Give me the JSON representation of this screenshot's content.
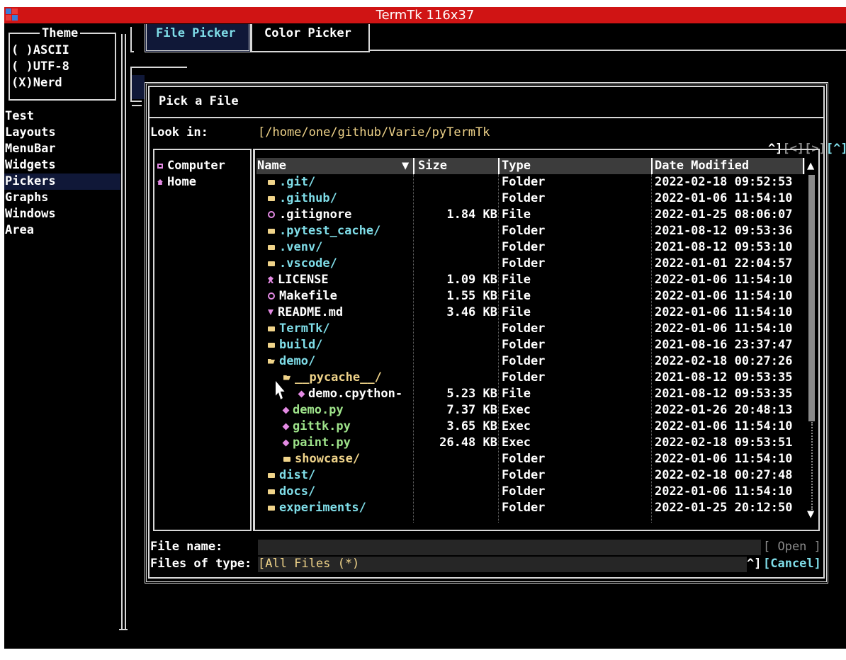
{
  "window": {
    "title": "TermTk 116x37"
  },
  "theme_box": {
    "title": "Theme",
    "options": [
      {
        "mark": "( )",
        "label": "ASCII"
      },
      {
        "mark": "( )",
        "label": "UTF-8"
      },
      {
        "mark": "(X)",
        "label": "Nerd"
      }
    ]
  },
  "sidebar": {
    "items": [
      "Test",
      "Layouts",
      "MenuBar",
      "Widgets",
      "Pickers",
      "Graphs",
      "Windows",
      "Area"
    ],
    "selected": "Pickers"
  },
  "tabs": [
    {
      "label": "File Picker",
      "active": true
    },
    {
      "label": "Color Picker",
      "active": false
    }
  ],
  "dialog": {
    "title": "Pick a File",
    "look_in_label": "Look in:",
    "path": "[/home/one/github/Varie/pyTermTk",
    "nav": {
      "up": "^]",
      "back": "[<]",
      "forward": "[>]",
      "up_btn": "[^]"
    },
    "places": [
      {
        "icon": "computer-icon",
        "label": "Computer"
      },
      {
        "icon": "home-icon",
        "label": "Home"
      }
    ],
    "columns": [
      "Name",
      "Size",
      "Type",
      "Date Modified"
    ],
    "sort_indicator": "▼",
    "rows": [
      {
        "indent": 0,
        "icon": "folder-icon",
        "name": ".git/",
        "size": "",
        "type": "Folder",
        "date": "2022-02-18 09:52:53",
        "color": "cyan"
      },
      {
        "indent": 0,
        "icon": "folder-icon",
        "name": ".github/",
        "size": "",
        "type": "Folder",
        "date": "2022-01-06 11:54:10",
        "color": "cyan"
      },
      {
        "indent": 0,
        "icon": "gear-icon",
        "name": ".gitignore",
        "size": "1.84 KB",
        "type": "File",
        "date": "2022-01-25 08:06:07",
        "color": "white"
      },
      {
        "indent": 0,
        "icon": "folder-icon",
        "name": ".pytest_cache/",
        "size": "",
        "type": "Folder",
        "date": "2021-08-12 09:53:36",
        "color": "cyan"
      },
      {
        "indent": 0,
        "icon": "folder-icon",
        "name": ".venv/",
        "size": "",
        "type": "Folder",
        "date": "2021-08-12 09:53:10",
        "color": "cyan"
      },
      {
        "indent": 0,
        "icon": "folder-icon",
        "name": ".vscode/",
        "size": "",
        "type": "Folder",
        "date": "2022-01-01 22:04:57",
        "color": "cyan"
      },
      {
        "indent": 0,
        "icon": "ribbon-icon",
        "name": "LICENSE",
        "size": "1.09 KB",
        "type": "File",
        "date": "2022-01-06 11:54:10",
        "color": "white"
      },
      {
        "indent": 0,
        "icon": "gear-icon",
        "name": "Makefile",
        "size": "1.55 KB",
        "type": "File",
        "date": "2022-01-06 11:54:10",
        "color": "white"
      },
      {
        "indent": 0,
        "icon": "markdown-icon",
        "name": "README.md",
        "size": "3.46 KB",
        "type": "File",
        "date": "2022-01-06 11:54:10",
        "color": "white"
      },
      {
        "indent": 0,
        "icon": "folder-icon",
        "name": "TermTk/",
        "size": "",
        "type": "Folder",
        "date": "2022-01-06 11:54:10",
        "color": "cyan"
      },
      {
        "indent": 0,
        "icon": "folder-icon",
        "name": "build/",
        "size": "",
        "type": "Folder",
        "date": "2021-08-16 23:37:47",
        "color": "cyan"
      },
      {
        "indent": 0,
        "icon": "folder-open-icon",
        "name": "demo/",
        "size": "",
        "type": "Folder",
        "date": "2022-02-18 00:27:26",
        "color": "cyan"
      },
      {
        "indent": 1,
        "icon": "folder-open-icon",
        "name": "__pycache__/",
        "size": "",
        "type": "Folder",
        "date": "2021-08-12 09:53:35",
        "color": "yellow"
      },
      {
        "indent": 2,
        "icon": "python-icon",
        "name": "demo.cpython-",
        "size": "5.23 KB",
        "type": "File",
        "date": "2021-08-12 09:53:35",
        "color": "white"
      },
      {
        "indent": 1,
        "icon": "python-icon",
        "name": "demo.py",
        "size": "7.37 KB",
        "type": "Exec",
        "date": "2022-01-26 20:48:13",
        "color": "green"
      },
      {
        "indent": 1,
        "icon": "python-icon",
        "name": "gittk.py",
        "size": "3.65 KB",
        "type": "Exec",
        "date": "2022-01-06 11:54:10",
        "color": "green"
      },
      {
        "indent": 1,
        "icon": "python-icon",
        "name": "paint.py",
        "size": "26.48 KB",
        "type": "Exec",
        "date": "2022-02-18 09:53:51",
        "color": "green"
      },
      {
        "indent": 1,
        "icon": "folder-icon",
        "name": "showcase/",
        "size": "",
        "type": "Folder",
        "date": "2022-01-06 11:54:10",
        "color": "yellow"
      },
      {
        "indent": 0,
        "icon": "folder-icon",
        "name": "dist/",
        "size": "",
        "type": "Folder",
        "date": "2022-02-18 00:27:48",
        "color": "cyan"
      },
      {
        "indent": 0,
        "icon": "folder-icon",
        "name": "docs/",
        "size": "",
        "type": "Folder",
        "date": "2022-01-06 11:54:10",
        "color": "cyan"
      },
      {
        "indent": 0,
        "icon": "folder-icon",
        "name": "experiments/",
        "size": "",
        "type": "Folder",
        "date": "2022-01-25 20:12:50",
        "color": "cyan"
      }
    ],
    "scroll": {
      "up": "▲",
      "down": "▼"
    },
    "file_name_label": "File name:",
    "file_name_value": "",
    "open_button": "[ Open ]",
    "files_of_type_label": "Files of type:",
    "file_type": "[All Files (*)",
    "file_type_arrow": "^]",
    "cancel_button": "[Cancel]"
  },
  "colors": {
    "titlebar": "#d01414",
    "cyan": "#7fdde8",
    "yellow": "#f0d48a",
    "green": "#9ee38a",
    "magenta": "#e38ae3"
  }
}
